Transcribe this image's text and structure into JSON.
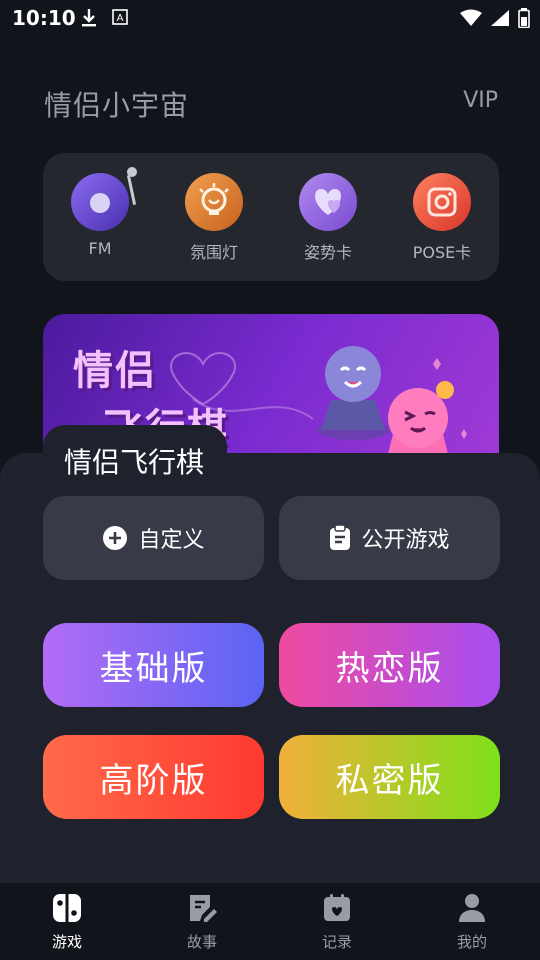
{
  "status": {
    "time": "10:10"
  },
  "header": {
    "title": "情侣小宇宙",
    "vip": "VIP"
  },
  "tools": [
    {
      "label": "FM",
      "icon": "radio-icon",
      "color": "#6a4bd6"
    },
    {
      "label": "氛围灯",
      "icon": "lamp-icon",
      "color": "#e07b2a"
    },
    {
      "label": "姿势卡",
      "icon": "heart-card-icon",
      "color": "#8a5ad6"
    },
    {
      "label": "POSE卡",
      "icon": "camera-icon",
      "color": "#e0463a"
    }
  ],
  "banner": {
    "title_line1": "情侣",
    "title_line2": "飞行棋"
  },
  "sheet": {
    "title": "情侣飞行棋",
    "custom_label": "自定义",
    "public_label": "公开游戏",
    "modes": [
      {
        "label": "基础版",
        "from": "#b26cf5",
        "to": "#5b64f3"
      },
      {
        "label": "热恋版",
        "from": "#f04aa0",
        "to": "#a64ef0"
      },
      {
        "label": "高阶版",
        "from": "#ff6a4a",
        "to": "#ff3a30"
      },
      {
        "label": "私密版",
        "from": "#f0b03a",
        "to": "#7fe01a"
      }
    ]
  },
  "tabbar": [
    {
      "label": "游戏",
      "icon": "gamepad-icon",
      "active": true
    },
    {
      "label": "故事",
      "icon": "edit-note-icon",
      "active": false
    },
    {
      "label": "记录",
      "icon": "calendar-heart-icon",
      "active": false
    },
    {
      "label": "我的",
      "icon": "user-icon",
      "active": false
    }
  ]
}
